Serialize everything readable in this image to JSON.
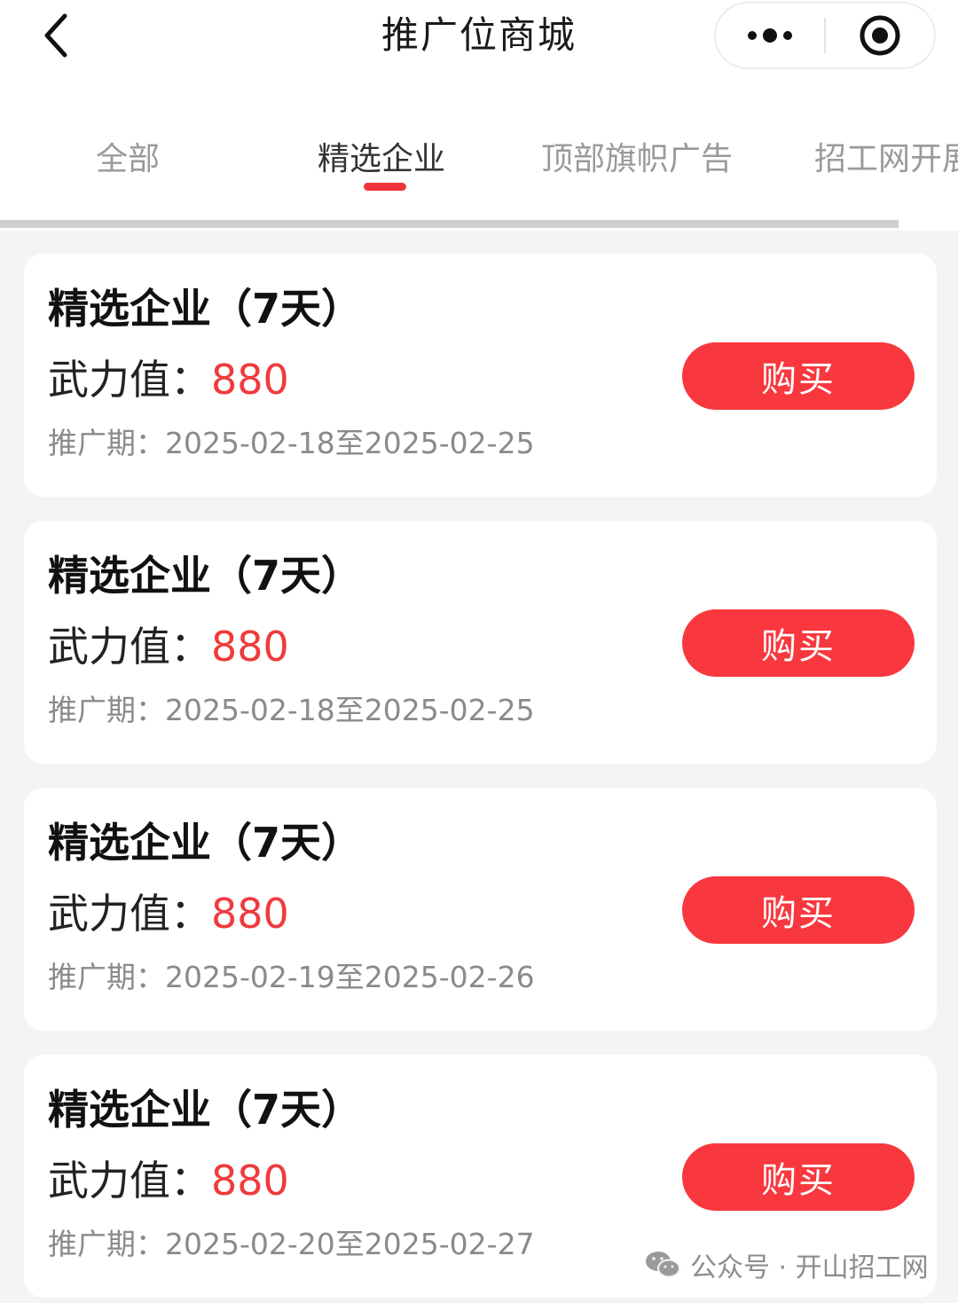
{
  "header": {
    "title": "推广位商城",
    "back_icon": "chevron-left-icon",
    "more_icon": "more-dots-icon",
    "close_icon": "target-close-icon"
  },
  "tabs": [
    {
      "label": "全部",
      "active": false
    },
    {
      "label": "精选企业",
      "active": true
    },
    {
      "label": "顶部旗帜广告",
      "active": false
    },
    {
      "label": "招工网开展",
      "active": false
    }
  ],
  "cards": [
    {
      "title": "精选企业（7天）",
      "power_label": "武力值：",
      "power_value": "880",
      "period": "推广期：2025-02-18至2025-02-25",
      "buy_label": "购买"
    },
    {
      "title": "精选企业（7天）",
      "power_label": "武力值：",
      "power_value": "880",
      "period": "推广期：2025-02-18至2025-02-25",
      "buy_label": "购买"
    },
    {
      "title": "精选企业（7天）",
      "power_label": "武力值：",
      "power_value": "880",
      "period": "推广期：2025-02-19至2025-02-26",
      "buy_label": "购买"
    },
    {
      "title": "精选企业（7天）",
      "power_label": "武力值：",
      "power_value": "880",
      "period": "推广期：2025-02-20至2025-02-27",
      "buy_label": "购买"
    }
  ],
  "watermark": {
    "text": "公众号 · 开山招工网",
    "icon": "wechat-icon"
  },
  "colors": {
    "accent": "#f8383e",
    "value_red": "#ef3b3d",
    "background": "#f4f4f4"
  }
}
